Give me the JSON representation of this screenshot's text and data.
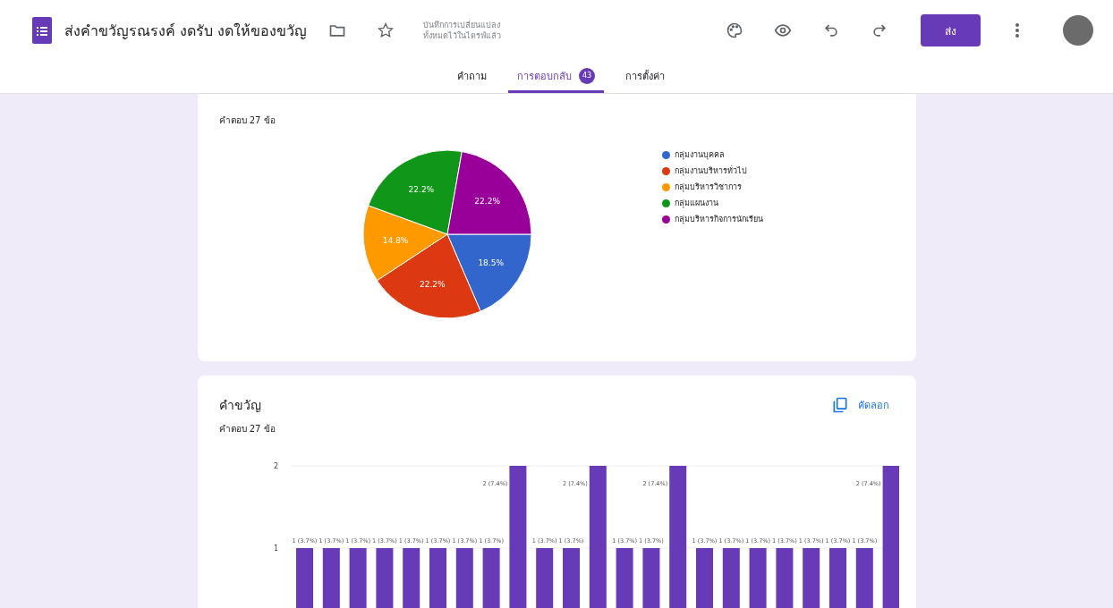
{
  "header": {
    "title": "ส่งคำขวัญรณรงค์ งดรับ งดให้ของขวัญ",
    "save_status": "บันทึกการเปลี่ยนแปลงทั้งหมดไว้ในไดรฟ์แล้ว",
    "send_button": "ส่ง"
  },
  "tabs": [
    {
      "label": "คำถาม",
      "selected": false
    },
    {
      "label": "การตอบกลับ",
      "selected": true,
      "badge": "43"
    },
    {
      "label": "การตั้งค่า",
      "selected": false
    }
  ],
  "pie_card": {
    "subtitle": "คำตอบ 27 ข้อ",
    "chart_data": {
      "type": "pie",
      "categories": [
        "กลุ่มงานบุคคล",
        "กลุ่มงานบริหารทั่วไป",
        "กลุ่มบริหารวิชาการ",
        "กลุ่มแผนงาน",
        "กลุ่มบริหารกิจการนักเรียน"
      ],
      "values": [
        18.5,
        22.2,
        14.8,
        22.2,
        22.2
      ],
      "colors": [
        "#3366cc",
        "#dc3912",
        "#ff9900",
        "#109618",
        "#990099"
      ],
      "value_labels": [
        "18.5%",
        "22.2%",
        "14.8%",
        "22.2%",
        "22.2%"
      ]
    }
  },
  "bar_card": {
    "title": "คำขวัญ",
    "subtitle": "คำตอบ 27 ข้อ",
    "copy_button": "คัดลอก",
    "chart_data": {
      "type": "bar",
      "series": [
        {
          "color": "#673ab7",
          "values": [
            1,
            1,
            1,
            1,
            1,
            1,
            1,
            1,
            2,
            1,
            1,
            2,
            1,
            1,
            2,
            1,
            1,
            1,
            1,
            1,
            1,
            1,
            2
          ]
        }
      ],
      "ylim": [
        0,
        2
      ],
      "yticks": [
        1,
        2
      ],
      "value_labels": [
        "1 (3.7%)",
        "1 (3.7%)",
        "1 (3.7%)",
        "1 (3.7%)",
        "1 (3.7%)",
        "1 (3.7%)",
        "1 (3.7%)",
        "1 (3.7%)",
        "2 (7.4%)",
        "1 (3.7%)",
        "1 (3.7%)",
        "2 (7.4%)",
        "1 (3.7%)",
        "1 (3.7%)",
        "2 (7.4%)",
        "1 (3.7%)",
        "1 (3.7%)",
        "1 (3.7%)",
        "1 (3.7%)",
        "1 (3.7%)",
        "1 (3.7%)",
        "1 (3.7%)",
        "2 (7.4%)"
      ]
    }
  }
}
